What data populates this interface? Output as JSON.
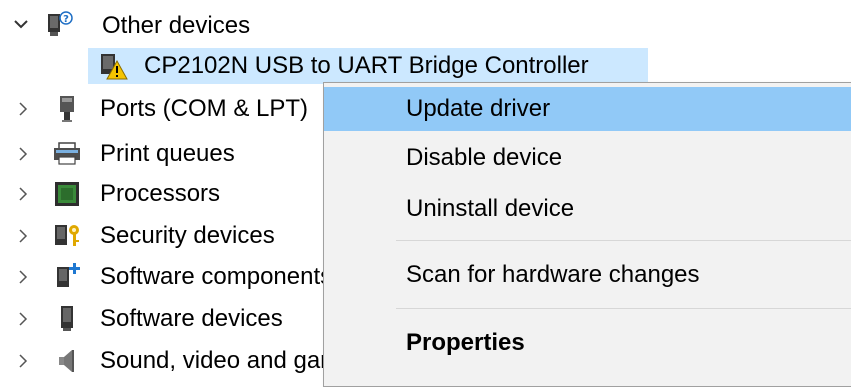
{
  "tree": {
    "other_devices": {
      "label": "Other devices",
      "icon": "unknown-device-icon",
      "expanded": true
    },
    "child": {
      "label": "CP2102N USB to UART Bridge Controller",
      "icon": "warning-device-icon",
      "selected": true
    },
    "categories": [
      {
        "label": "Ports (COM & LPT)",
        "icon": "port-icon"
      },
      {
        "label": "Print queues",
        "icon": "printer-icon"
      },
      {
        "label": "Processors",
        "icon": "processor-icon"
      },
      {
        "label": "Security devices",
        "icon": "security-key-icon"
      },
      {
        "label": "Software components",
        "icon": "software-component-icon"
      },
      {
        "label": "Software devices",
        "icon": "software-device-icon"
      },
      {
        "label": "Sound, video and game controllers",
        "icon": "speaker-icon"
      }
    ]
  },
  "context_menu": {
    "items": [
      {
        "label": "Update driver",
        "highlighted": true
      },
      {
        "label": "Disable device"
      },
      {
        "label": "Uninstall device"
      },
      {
        "label": "Scan for hardware changes"
      },
      {
        "label": "Properties",
        "bold": true
      }
    ]
  },
  "colors": {
    "selection": "#cce8ff",
    "menu_highlight": "#91c9f7",
    "menu_background": "#f2f2f2"
  }
}
